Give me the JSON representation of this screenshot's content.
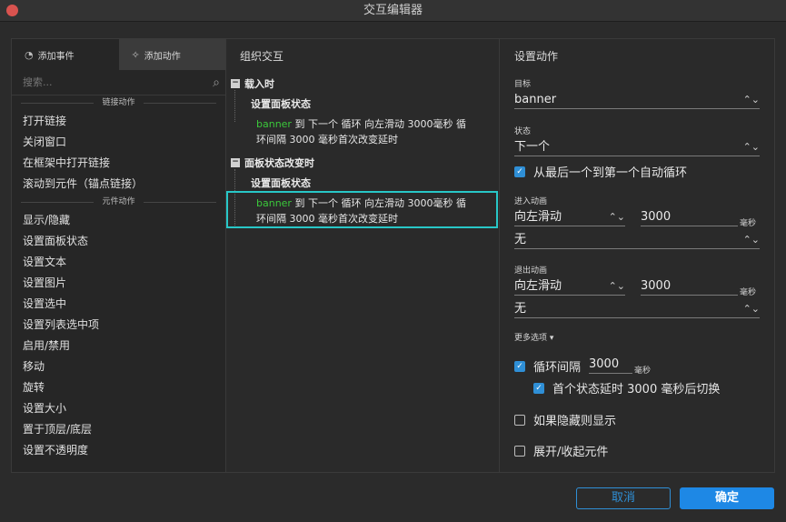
{
  "window": {
    "title": "交互编辑器"
  },
  "left": {
    "tabs": [
      {
        "icon": "event-icon",
        "label": "添加事件"
      },
      {
        "icon": "sparkle-icon",
        "label": "添加动作"
      }
    ],
    "search_placeholder": "搜索...",
    "sections": [
      {
        "title": "链接动作",
        "items": [
          "打开链接",
          "关闭窗口",
          "在框架中打开链接",
          "滚动到元件（锚点链接）"
        ]
      },
      {
        "title": "元件动作",
        "items": [
          "显示/隐藏",
          "设置面板状态",
          "设置文本",
          "设置图片",
          "设置选中",
          "设置列表选中项",
          "启用/禁用",
          "移动",
          "旋转",
          "设置大小",
          "置于顶层/底层",
          "设置不透明度"
        ]
      }
    ]
  },
  "middle": {
    "title": "组织交互",
    "events": [
      {
        "label": "载入时",
        "toggle": "−",
        "case_title": "设置面板状态",
        "action_target": "banner",
        "action_line1": " 到 下一个 循环 向左滑动 3000毫秒 循",
        "action_line2": "环间隔 3000 毫秒首次改变延时"
      },
      {
        "label": "面板状态改变时",
        "toggle": "−",
        "case_title": "设置面板状态",
        "action_target": "banner",
        "action_line1": " 到 下一个 循环 向左滑动 3000毫秒 循",
        "action_line2": "环间隔 3000 毫秒首次改变延时"
      }
    ]
  },
  "right": {
    "title": "设置动作",
    "target_label": "目标",
    "target_value": "banner",
    "state_label": "状态",
    "state_value": "下一个",
    "wrap_label": "从最后一个到第一个自动循环",
    "wrap_checked": true,
    "enter_label": "进入动画",
    "enter_anim": "向左滑动",
    "enter_ms": "3000",
    "enter_easing": "无",
    "exit_label": "退出动画",
    "exit_anim": "向左滑动",
    "exit_ms": "3000",
    "exit_easing": "无",
    "unit_ms": "毫秒",
    "more_options": "更多选项 ▾",
    "loop_label": "循环间隔",
    "loop_value": "3000",
    "loop_checked": true,
    "first_delay_label": "首个状态延时 3000 毫秒后切换",
    "first_delay_checked": true,
    "show_if_hidden_label": "如果隐藏则显示",
    "show_if_hidden_checked": false,
    "expand_collapse_label": "展开/收起元件",
    "expand_collapse_checked": false
  },
  "footer": {
    "cancel": "取消",
    "ok": "确定"
  },
  "colors": {
    "accent": "#2f8fd6",
    "selection": "#28c7c7",
    "target": "#3bc83b"
  }
}
